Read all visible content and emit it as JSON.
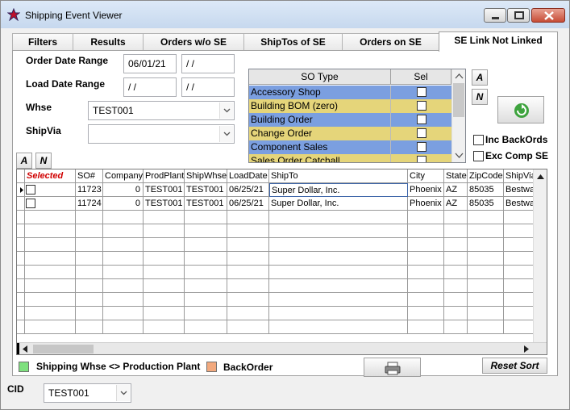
{
  "window": {
    "title": "Shipping Event Viewer"
  },
  "tabs": [
    {
      "label": "Filters"
    },
    {
      "label": "Results"
    },
    {
      "label": "Orders w/o SE"
    },
    {
      "label": "ShipTos of  SE"
    },
    {
      "label": "Orders on SE"
    },
    {
      "label": "SE Link Not Linked"
    }
  ],
  "filters": {
    "order_date_label": "Order Date Range",
    "order_date_from": "06/01/21",
    "order_date_to": " / /",
    "load_date_label": "Load Date Range",
    "load_date_from": " / /",
    "load_date_to": " / /",
    "whse_label": "Whse",
    "whse_value": "TEST001",
    "shipvia_label": "ShipVia",
    "shipvia_value": ""
  },
  "sotype": {
    "col_type": "SO Type",
    "col_sel": "Sel",
    "rows": [
      {
        "name": "Accessory Shop",
        "color": "#7b9fe0"
      },
      {
        "name": "Building BOM (zero)",
        "color": "#e5d57a"
      },
      {
        "name": "Building Order",
        "color": "#7b9fe0"
      },
      {
        "name": "Change Order",
        "color": "#e5d57a"
      },
      {
        "name": "Component Sales",
        "color": "#7b9fe0"
      },
      {
        "name": "Sales Order Catchall",
        "color": "#e5d57a"
      }
    ]
  },
  "buttons": {
    "all": "A",
    "none": "N",
    "reset_sort": "Reset Sort"
  },
  "options": {
    "inc_backords": "Inc BackOrds",
    "exc_comp_se": "Exc Comp SE"
  },
  "grid": {
    "columns": [
      "Selected",
      "SO#",
      "Company",
      "ProdPlant",
      "ShipWhse",
      "LoadDate",
      "ShipTo",
      "City",
      "State",
      "ZipCode",
      "ShipVia"
    ],
    "rows": [
      [
        "",
        "11723",
        "0",
        "TEST001",
        "TEST001",
        "06/25/21",
        "Super Dollar, Inc.",
        "Phoenix",
        "AZ",
        "85035",
        "Bestwa"
      ],
      [
        "",
        "11724",
        "0",
        "TEST001",
        "TEST001",
        "06/25/21",
        "Super Dollar, Inc.",
        "Phoenix",
        "AZ",
        "85035",
        "Bestwa"
      ]
    ]
  },
  "legend": {
    "plant_mismatch": "Shipping Whse <> Production Plant",
    "plant_mismatch_color": "#7ee07e",
    "backorder": "BackOrder",
    "backorder_color": "#f2a97e"
  },
  "footer": {
    "cid_label": "CID",
    "cid_value": "TEST001"
  }
}
